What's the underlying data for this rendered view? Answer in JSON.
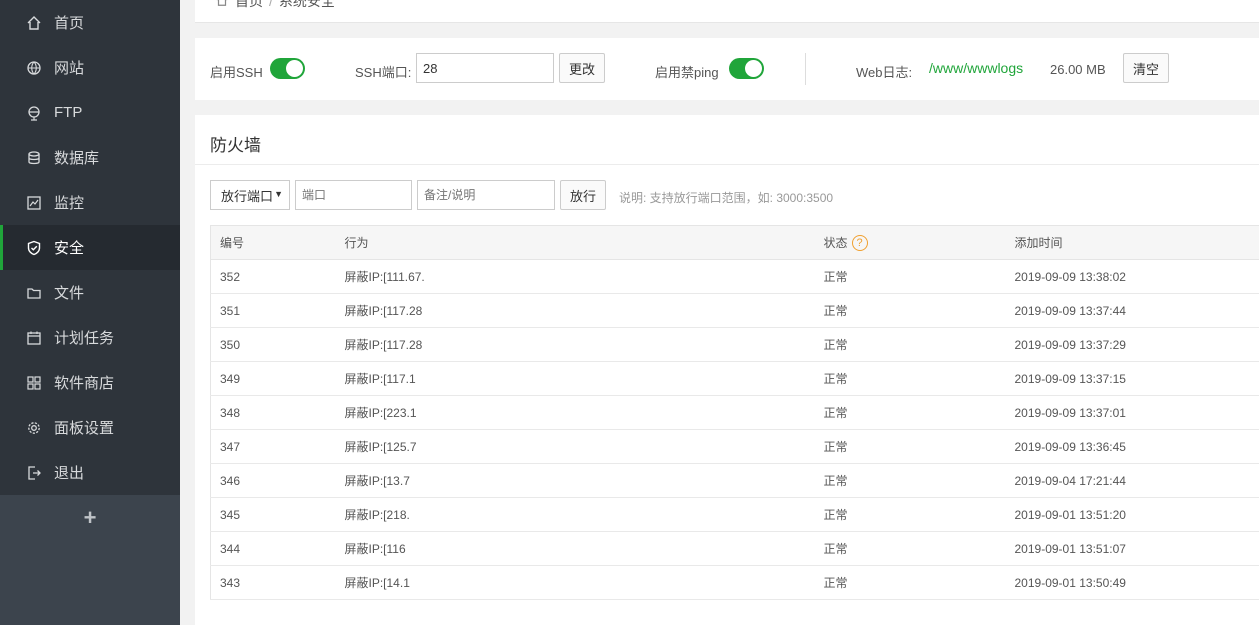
{
  "sidebar": {
    "items": [
      {
        "label": "首页",
        "icon": "home-icon",
        "active": false
      },
      {
        "label": "网站",
        "icon": "globe-icon",
        "active": false
      },
      {
        "label": "FTP",
        "icon": "ftp-icon",
        "active": false
      },
      {
        "label": "数据库",
        "icon": "database-icon",
        "active": false
      },
      {
        "label": "监控",
        "icon": "monitor-icon",
        "active": false
      },
      {
        "label": "安全",
        "icon": "shield-icon",
        "active": true
      },
      {
        "label": "文件",
        "icon": "folder-icon",
        "active": false
      },
      {
        "label": "计划任务",
        "icon": "calendar-icon",
        "active": false
      },
      {
        "label": "软件商店",
        "icon": "apps-icon",
        "active": false
      },
      {
        "label": "面板设置",
        "icon": "gear-icon",
        "active": false
      },
      {
        "label": "退出",
        "icon": "logout-icon",
        "active": false
      }
    ],
    "add_label": "+"
  },
  "breadcrumb": {
    "home": "首页",
    "separator": "/",
    "current": "系统安全"
  },
  "ssh": {
    "enable_ssh_label": "启用SSH",
    "port_label": "SSH端口:",
    "port_value": "28",
    "change_button": "更改",
    "ping_label": "启用禁ping",
    "weblog_label": "Web日志:",
    "weblog_path": "/www/wwwlogs",
    "weblog_size": "26.00 MB",
    "clear_button": "清空"
  },
  "firewall": {
    "title": "防火墙",
    "select_value": "放行端口",
    "port_placeholder": "端口",
    "note_placeholder": "备注/说明",
    "allow_button": "放行",
    "hint": "说明: 支持放行端口范围，如: 3000:3500",
    "columns": {
      "id": "编号",
      "action": "行为",
      "status": "状态",
      "time": "添加时间"
    },
    "help_glyph": "?",
    "rows": [
      {
        "id": "352",
        "action": "屏蔽IP:[111.67.",
        "status": "正常",
        "time": "2019-09-09 13:38:02"
      },
      {
        "id": "351",
        "action": "屏蔽IP:[117.28",
        "status": "正常",
        "time": "2019-09-09 13:37:44"
      },
      {
        "id": "350",
        "action": "屏蔽IP:[117.28",
        "status": "正常",
        "time": "2019-09-09 13:37:29"
      },
      {
        "id": "349",
        "action": "屏蔽IP:[117.1",
        "status": "正常",
        "time": "2019-09-09 13:37:15"
      },
      {
        "id": "348",
        "action": "屏蔽IP:[223.1",
        "status": "正常",
        "time": "2019-09-09 13:37:01"
      },
      {
        "id": "347",
        "action": "屏蔽IP:[125.7",
        "status": "正常",
        "time": "2019-09-09 13:36:45"
      },
      {
        "id": "346",
        "action": "屏蔽IP:[13.7",
        "status": "正常",
        "time": "2019-09-04 17:21:44"
      },
      {
        "id": "345",
        "action": "屏蔽IP:[218.",
        "status": "正常",
        "time": "2019-09-01 13:51:20"
      },
      {
        "id": "344",
        "action": "屏蔽IP:[116",
        "status": "正常",
        "time": "2019-09-01 13:51:07"
      },
      {
        "id": "343",
        "action": "屏蔽IP:[14.1",
        "status": "正常",
        "time": "2019-09-01 13:50:49"
      }
    ]
  }
}
